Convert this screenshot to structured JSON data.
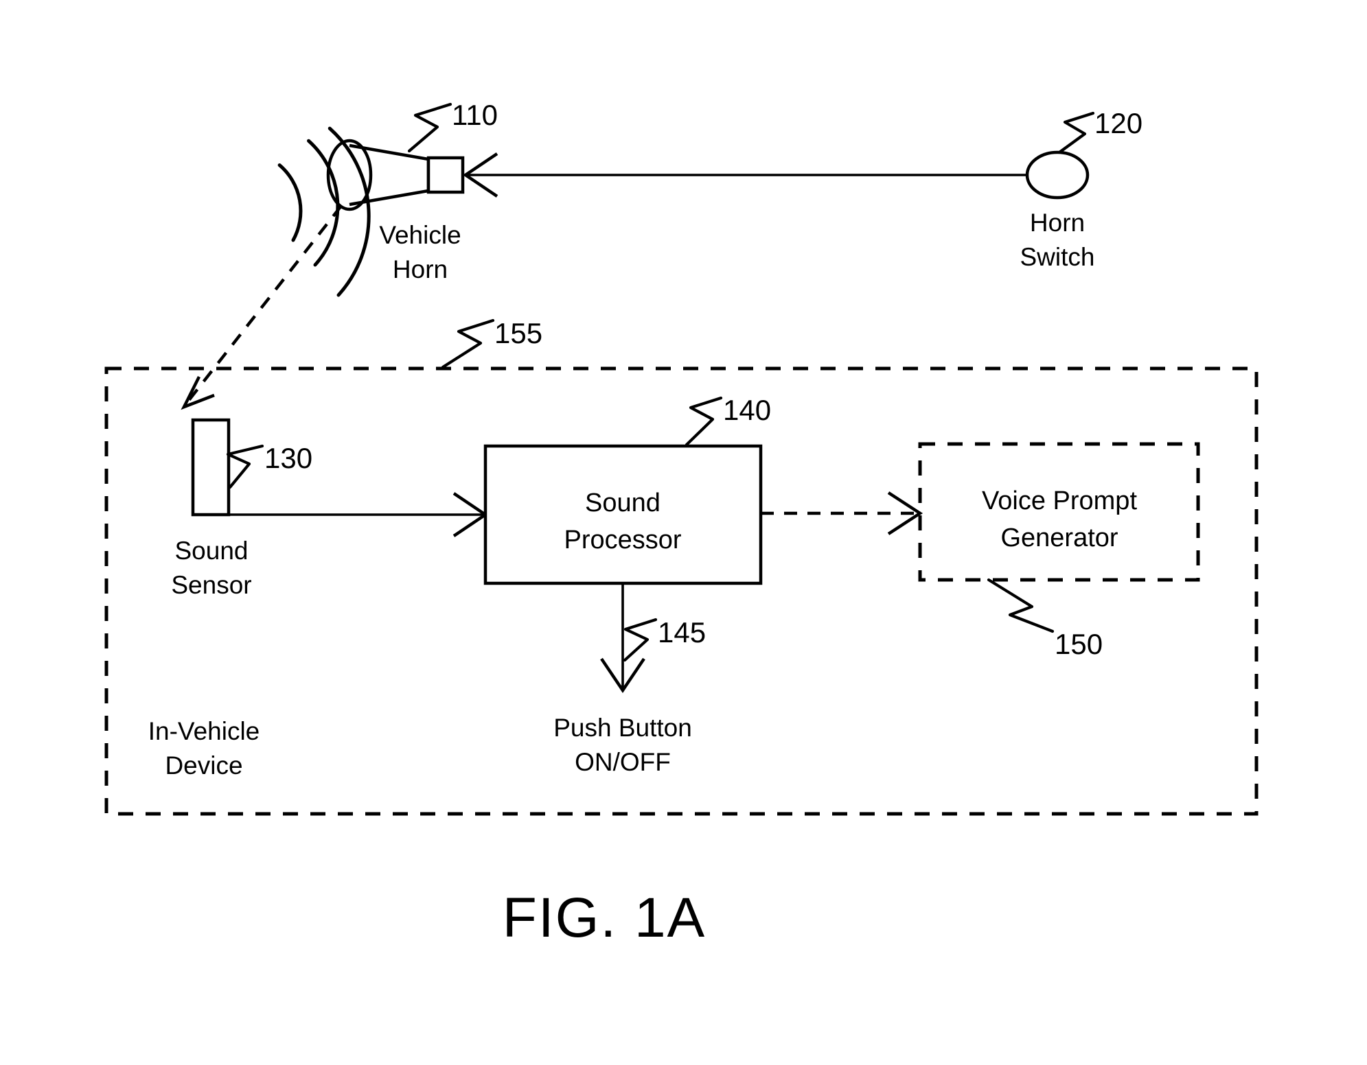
{
  "figure": {
    "title": "FIG. 1A",
    "reference_numerals": {
      "vehicle_horn": "110",
      "horn_switch": "120",
      "sound_sensor": "130",
      "sound_processor": "140",
      "push_button": "145",
      "voice_prompt_generator": "150",
      "in_vehicle_device": "155"
    },
    "nodes": {
      "vehicle_horn": {
        "label_line1": "Vehicle",
        "label_line2": "Horn",
        "ref": "110",
        "shape": "horn-loudspeaker"
      },
      "horn_switch": {
        "label_line1": "Horn",
        "label_line2": "Switch",
        "ref": "120",
        "shape": "ellipse"
      },
      "sound_sensor": {
        "label_line1": "Sound",
        "label_line2": "Sensor",
        "ref": "130",
        "shape": "tall-rectangle"
      },
      "sound_processor": {
        "label_line1": "Sound",
        "label_line2": "Processor",
        "ref": "140",
        "shape": "solid-rectangle"
      },
      "push_button": {
        "label_line1": "Push Button",
        "label_line2": "ON/OFF",
        "ref": "145",
        "shape": "text-only"
      },
      "voice_prompt_generator": {
        "label_line1": "Voice Prompt",
        "label_line2": "Generator",
        "ref": "150",
        "shape": "dashed-rectangle"
      },
      "in_vehicle_device": {
        "label_line1": "In-Vehicle",
        "label_line2": "Device",
        "ref": "155",
        "shape": "dashed-enclosure"
      }
    },
    "connections": [
      {
        "from": "horn_switch",
        "to": "vehicle_horn",
        "style": "solid",
        "arrow": "open-left"
      },
      {
        "from": "vehicle_horn",
        "to": "sound_sensor",
        "style": "dashed",
        "arrow": "open-down-left"
      },
      {
        "from": "sound_sensor",
        "to": "sound_processor",
        "style": "solid",
        "arrow": "open-right"
      },
      {
        "from": "sound_processor",
        "to": "voice_prompt_generator",
        "style": "dashed",
        "arrow": "open-right"
      },
      {
        "from": "sound_processor",
        "to": "push_button",
        "style": "solid",
        "arrow": "open-down"
      }
    ],
    "colors": {
      "line": "#000000",
      "background": "#ffffff",
      "text": "#000000"
    }
  }
}
